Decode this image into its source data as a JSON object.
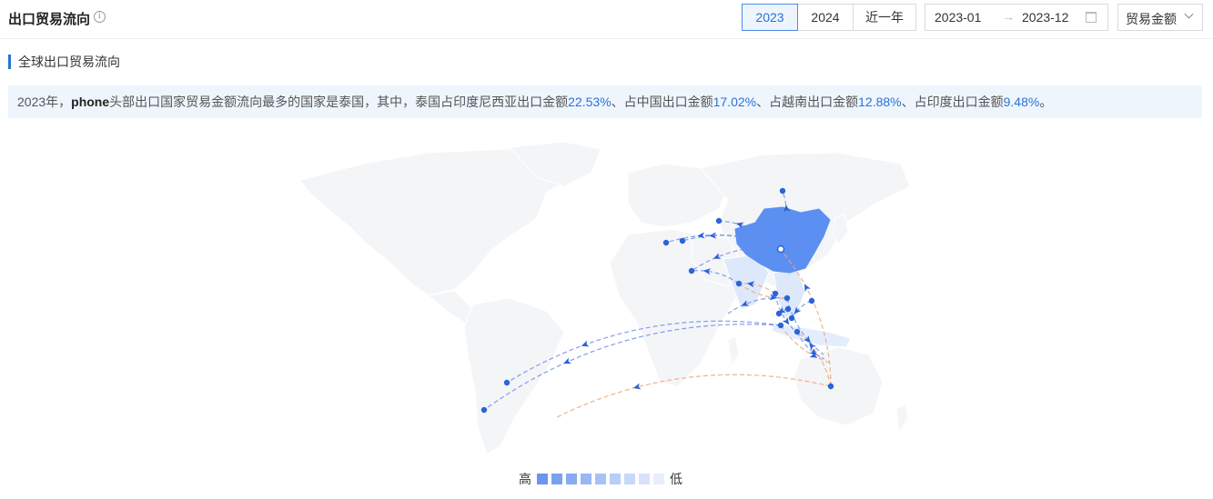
{
  "header": {
    "title": "出口贸易流向",
    "info_icon": "info-icon",
    "tabs": [
      {
        "label": "2023",
        "active": true
      },
      {
        "label": "2024",
        "active": false
      },
      {
        "label": "近一年",
        "active": false
      }
    ],
    "date_range": {
      "start": "2023-01",
      "separator": "→",
      "end": "2023-12",
      "icon": "calendar-icon"
    },
    "metric_select": {
      "value": "贸易金额",
      "icon": "chevron-down-icon"
    }
  },
  "section": {
    "title": "全球出口贸易流向"
  },
  "summary": {
    "prefix": "2023年，",
    "product": "phone",
    "text1": "头部出口国家贸易金额流向最多的国家是泰国，其中，泰国占印度尼西亚出口金额",
    "pct1": "22.53%",
    "text2": "、占中国出口金额",
    "pct2": "17.02%",
    "text3": "、占越南出口金额",
    "pct3": "12.88%",
    "text4": "、占印度出口金额",
    "pct4": "9.48%",
    "suffix": "。"
  },
  "colors": {
    "accent": "#2a73d6",
    "map_land": "#f4f5f7",
    "china_fill": "#5b8ff1",
    "flow_blue": "#6f8ee8",
    "flow_orange": "#f0a37a"
  },
  "legend": {
    "high_label": "高",
    "low_label": "低",
    "swatches": [
      "#6b95ef",
      "#7aa1f1",
      "#88abf3",
      "#98b7f4",
      "#a8c2f6",
      "#b8cdf8",
      "#c8d8f9",
      "#d8e3fb",
      "#e8eefd"
    ]
  }
}
